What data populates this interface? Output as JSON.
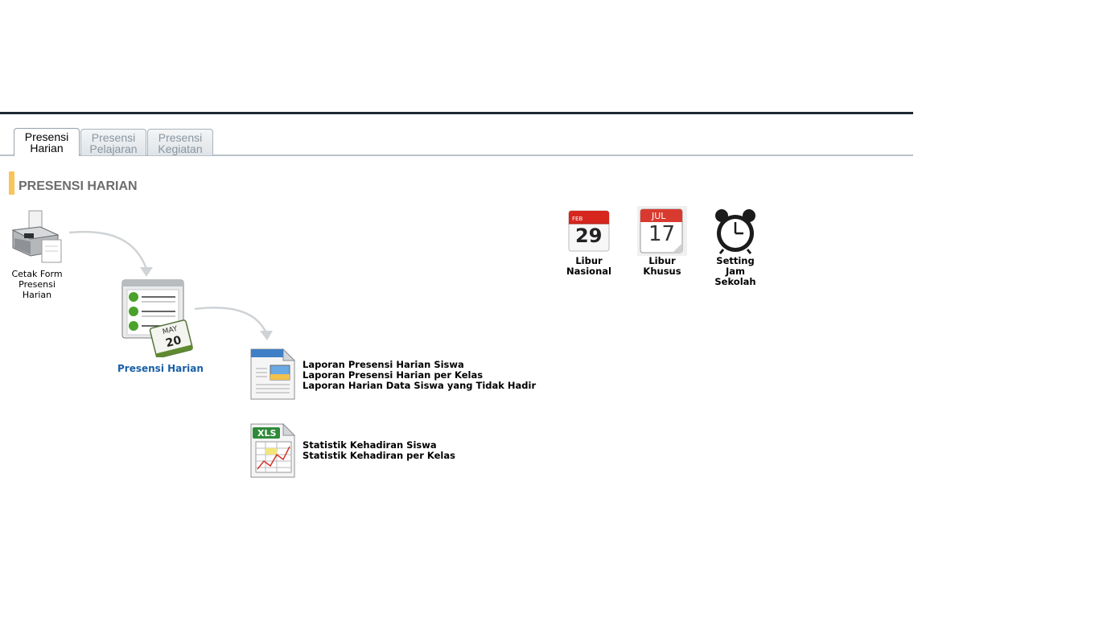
{
  "tabs": [
    {
      "line1": "Presensi",
      "line2": "Harian",
      "active": true
    },
    {
      "line1": "Presensi",
      "line2": "Pelajaran",
      "active": false
    },
    {
      "line1": "Presensi",
      "line2": "Kegiatan",
      "active": false
    }
  ],
  "section": {
    "title": "PRESENSI HARIAN"
  },
  "flow": {
    "print_form": {
      "line1": "Cetak Form",
      "line2": "Presensi Harian"
    },
    "daily_attendance": {
      "label": "Presensi Harian",
      "calendar_month": "MAY",
      "calendar_day": "20"
    }
  },
  "reports": {
    "items": [
      "Laporan Presensi Harian Siswa",
      "Laporan Presensi Harian per Kelas",
      "Laporan Harian Data Siswa yang Tidak Hadir"
    ]
  },
  "statistics": {
    "icon_label": "XLS",
    "items": [
      "Statistik Kehadiran Siswa",
      "Statistik Kehadiran per Kelas"
    ]
  },
  "settings": {
    "national_holiday": {
      "line1": "Libur",
      "line2": "Nasional",
      "cal_month": "FEB",
      "cal_day": "29"
    },
    "special_holiday": {
      "line1": "Libur",
      "line2": "Khusus",
      "cal_month": "JUL",
      "cal_day": "17"
    },
    "school_hours": {
      "line1": "Setting",
      "line2": "Jam",
      "line3": "Sekolah"
    }
  },
  "colors": {
    "accent": "#f9c45a",
    "link_blue": "#1a5fa6",
    "header_dark": "#1d2a35"
  }
}
